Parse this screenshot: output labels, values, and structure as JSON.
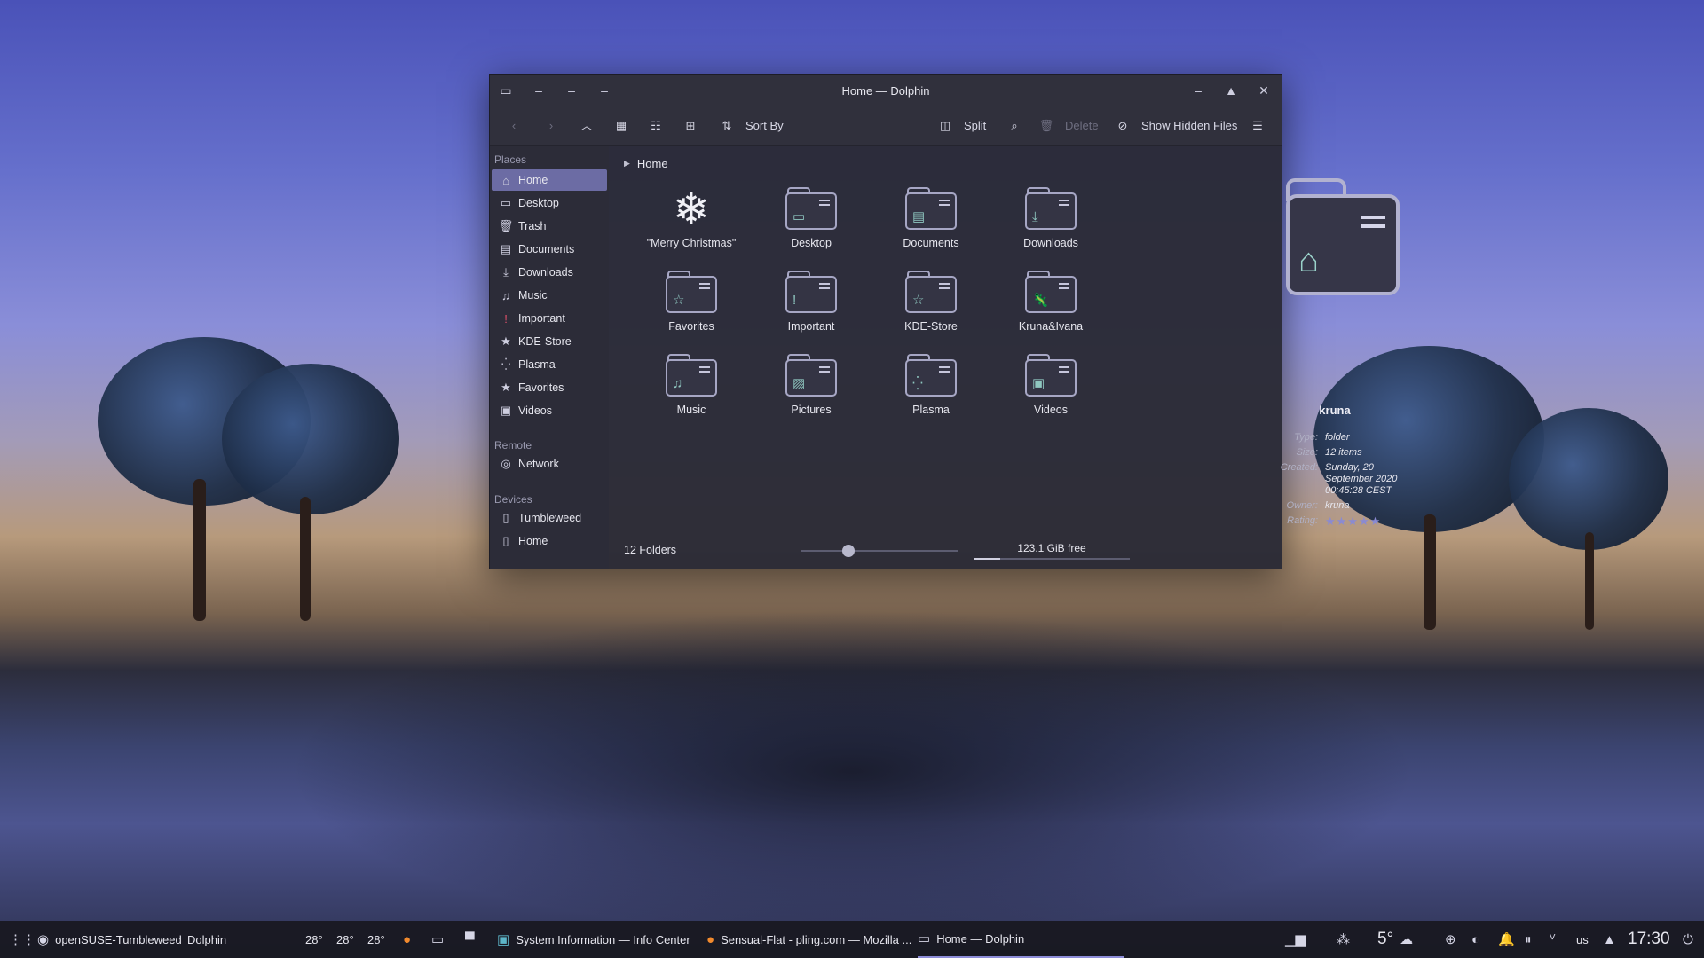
{
  "window": {
    "title": "Home — Dolphin",
    "toolbar": {
      "sort_by": "Sort By",
      "split": "Split",
      "delete": "Delete",
      "show_hidden": "Show Hidden Files"
    }
  },
  "sidebar": {
    "places_label": "Places",
    "places": [
      {
        "label": "Home",
        "icon": "home-icon"
      },
      {
        "label": "Desktop",
        "icon": "desktop-icon"
      },
      {
        "label": "Trash",
        "icon": "trash-icon"
      },
      {
        "label": "Documents",
        "icon": "documents-icon"
      },
      {
        "label": "Downloads",
        "icon": "downloads-icon"
      },
      {
        "label": "Music",
        "icon": "music-icon"
      },
      {
        "label": "Important",
        "icon": "important-icon"
      },
      {
        "label": "KDE-Store",
        "icon": "star-icon"
      },
      {
        "label": "Plasma",
        "icon": "plasma-icon"
      },
      {
        "label": "Favorites",
        "icon": "star-icon"
      },
      {
        "label": "Videos",
        "icon": "videos-icon"
      }
    ],
    "remote_label": "Remote",
    "remote": [
      {
        "label": "Network",
        "icon": "network-icon"
      }
    ],
    "devices_label": "Devices",
    "devices": [
      {
        "label": "Tumbleweed",
        "icon": "drive-icon"
      },
      {
        "label": "Home",
        "icon": "drive-icon"
      }
    ]
  },
  "breadcrumb": {
    "current": "Home"
  },
  "items": [
    {
      "label": "\"Merry Christmas\"",
      "icon": "snowflake-icon"
    },
    {
      "label": "Desktop",
      "icon": "desktop-folder-icon"
    },
    {
      "label": "Documents",
      "icon": "documents-folder-icon"
    },
    {
      "label": "Downloads",
      "icon": "downloads-folder-icon"
    },
    {
      "label": "Favorites",
      "icon": "favorites-folder-icon"
    },
    {
      "label": "Important",
      "icon": "important-folder-icon"
    },
    {
      "label": "KDE-Store",
      "icon": "kde-store-folder-icon"
    },
    {
      "label": "Kruna&Ivana",
      "icon": "kruna-ivana-folder-icon"
    },
    {
      "label": "Music",
      "icon": "music-folder-icon"
    },
    {
      "label": "Pictures",
      "icon": "pictures-folder-icon"
    },
    {
      "label": "Plasma",
      "icon": "plasma-folder-icon"
    },
    {
      "label": "Videos",
      "icon": "videos-folder-icon"
    }
  ],
  "info_panel": {
    "name": "kruna",
    "type_label": "Type:",
    "type": "folder",
    "size_label": "Size:",
    "size": "12 items",
    "created_label": "Created:",
    "created": "Sunday, 20 September 2020 00:45:28 CEST",
    "owner_label": "Owner:",
    "owner": "kruna",
    "rating_label": "Rating:",
    "rating": 5
  },
  "status": {
    "count": "12 Folders",
    "zoom_level": 0.3,
    "free_space": "123.1 GiB free",
    "used_fraction": 0.17
  },
  "taskbar": {
    "distro": "openSUSE-Tumbleweed",
    "app": "Dolphin",
    "temps": [
      "28°",
      "28°",
      "28°"
    ],
    "tasks": [
      {
        "label": "System Information — Info Center"
      },
      {
        "label": "Sensual-Flat - pling.com — Mozilla ..."
      },
      {
        "label": "Home — Dolphin"
      }
    ],
    "weather": "5°",
    "keyboard_layout": "us",
    "clock": "17:30"
  },
  "colors": {
    "accent": "#8d8dd8",
    "selection": "#6c6ca4"
  }
}
